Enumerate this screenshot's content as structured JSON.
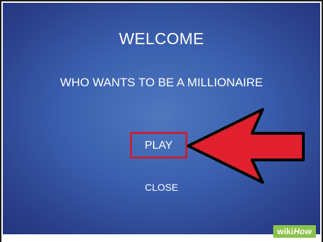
{
  "slide": {
    "title": "WELCOME",
    "subtitle": "WHO WANTS TO BE A MILLIONAIRE",
    "play_label": "PLAY",
    "close_label": "CLOSE"
  },
  "watermark": {
    "prefix": "wiki",
    "suffix": "How"
  },
  "colors": {
    "background": "#3a5fae",
    "highlight_border": "#c4213a",
    "arrow_fill": "#e0202e",
    "watermark_bg": "#8bc34a"
  }
}
